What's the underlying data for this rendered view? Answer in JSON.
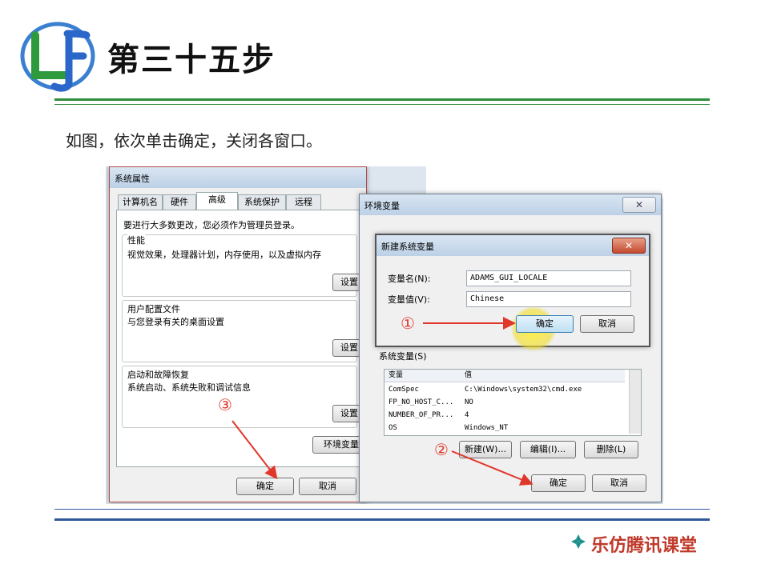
{
  "slide": {
    "title": "第三十五步",
    "instruction": "如图，依次单击确定，关闭各窗口。",
    "brand": "乐仿腾讯课堂",
    "logo_letters": "LF",
    "colors": {
      "header_rule": "#2e8b3a",
      "footer_rule": "#2f5a9a",
      "brand": "#c0392b",
      "callout": "#e1372b"
    }
  },
  "sysprops": {
    "title": "系统属性",
    "tabs": [
      "计算机名",
      "硬件",
      "高级",
      "系统保护",
      "远程"
    ],
    "active_tab": "高级",
    "admin_note": "要进行大多数更改，您必须作为管理员登录。",
    "perf": {
      "label": "性能",
      "desc": "视觉效果，处理器计划，内存使用，以及虚拟内存",
      "button": "设置"
    },
    "profile": {
      "label": "用户配置文件",
      "desc": "与您登录有关的桌面设置",
      "button": "设置"
    },
    "startup": {
      "label": "启动和故障恢复",
      "desc": "系统启动、系统失败和调试信息",
      "button": "设置"
    },
    "env_button": "环境变量",
    "ok": "确定",
    "cancel": "取消"
  },
  "envwin": {
    "title": "环境变量",
    "sys_section": "系统变量(S)",
    "col_name": "变量",
    "col_value": "值",
    "rows": [
      {
        "name": "ComSpec",
        "value": "C:\\Windows\\system32\\cmd.exe"
      },
      {
        "name": "FP_NO_HOST_C...",
        "value": "NO"
      },
      {
        "name": "NUMBER_OF_PR...",
        "value": "4"
      },
      {
        "name": "OS",
        "value": "Windows_NT"
      }
    ],
    "new": "新建(W)...",
    "edit": "编辑(I)...",
    "delete": "删除(L)",
    "ok": "确定",
    "cancel": "取消"
  },
  "newvar": {
    "title": "新建系统变量",
    "name_label": "变量名(N):",
    "name_value": "ADAMS_GUI_LOCALE",
    "value_label": "变量值(V):",
    "value_value": "Chinese",
    "ok": "确定",
    "cancel": "取消"
  },
  "callouts": {
    "one": "①",
    "two": "②",
    "three": "③"
  }
}
